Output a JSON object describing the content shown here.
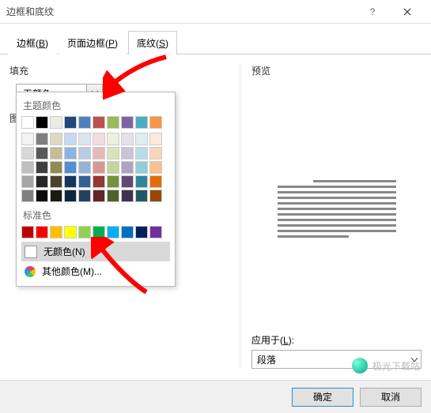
{
  "window": {
    "title": "边框和底纹"
  },
  "tabs": {
    "border": {
      "label": "边框(",
      "key": "B",
      "suffix": ")"
    },
    "pageBorder": {
      "label": "页面边框(",
      "key": "P",
      "suffix": ")"
    },
    "shading": {
      "label": "底纹(",
      "key": "S",
      "suffix": ")"
    }
  },
  "fill": {
    "label": "填充",
    "current": "无颜色",
    "partial_label": "图"
  },
  "palette": {
    "theme_heading": "主题颜色",
    "standard_heading": "标准色",
    "theme_row1": [
      "#ffffff",
      "#000000",
      "#eeece1",
      "#1f497d",
      "#4f81bd",
      "#c0504d",
      "#9bbb59",
      "#8064a2",
      "#4bacc6",
      "#f79646"
    ],
    "theme_rows": [
      [
        "#f2f2f2",
        "#7f7f7f",
        "#ddd9c3",
        "#c6d9f0",
        "#dbe5f1",
        "#f2dcdb",
        "#ebf1dd",
        "#e5e0ec",
        "#dbeef3",
        "#fde9d9"
      ],
      [
        "#d8d8d8",
        "#595959",
        "#c4bd97",
        "#8db3e2",
        "#b8cce4",
        "#e5b9b7",
        "#d7e3bc",
        "#ccc1d9",
        "#b7dde8",
        "#fbd5b5"
      ],
      [
        "#bfbfbf",
        "#3f3f3f",
        "#938953",
        "#548dd4",
        "#95b3d7",
        "#d99694",
        "#c3d69b",
        "#b2a2c7",
        "#92cddc",
        "#fac08f"
      ],
      [
        "#a5a5a5",
        "#262626",
        "#494429",
        "#17365d",
        "#366092",
        "#953734",
        "#76923c",
        "#5f497a",
        "#31859b",
        "#e36c09"
      ],
      [
        "#7f7f7f",
        "#0c0c0c",
        "#1d1b10",
        "#0f243e",
        "#244061",
        "#632423",
        "#4f6128",
        "#3f3151",
        "#205867",
        "#974806"
      ]
    ],
    "standard_row": [
      "#c00000",
      "#ff0000",
      "#ffc000",
      "#ffff00",
      "#92d050",
      "#00b050",
      "#00b0f0",
      "#0070c0",
      "#002060",
      "#7030a0"
    ],
    "no_color": {
      "label": "无颜色(",
      "key": "N",
      "suffix": ")"
    },
    "more_colors": {
      "label": "其他颜色(",
      "key": "M",
      "suffix": ")..."
    }
  },
  "preview": {
    "label": "预览"
  },
  "apply": {
    "label": "应用于(",
    "key": "L",
    "suffix": "):",
    "value": "段落"
  },
  "buttons": {
    "ok": "确定",
    "cancel": "取消"
  },
  "watermark": "极光下载站"
}
